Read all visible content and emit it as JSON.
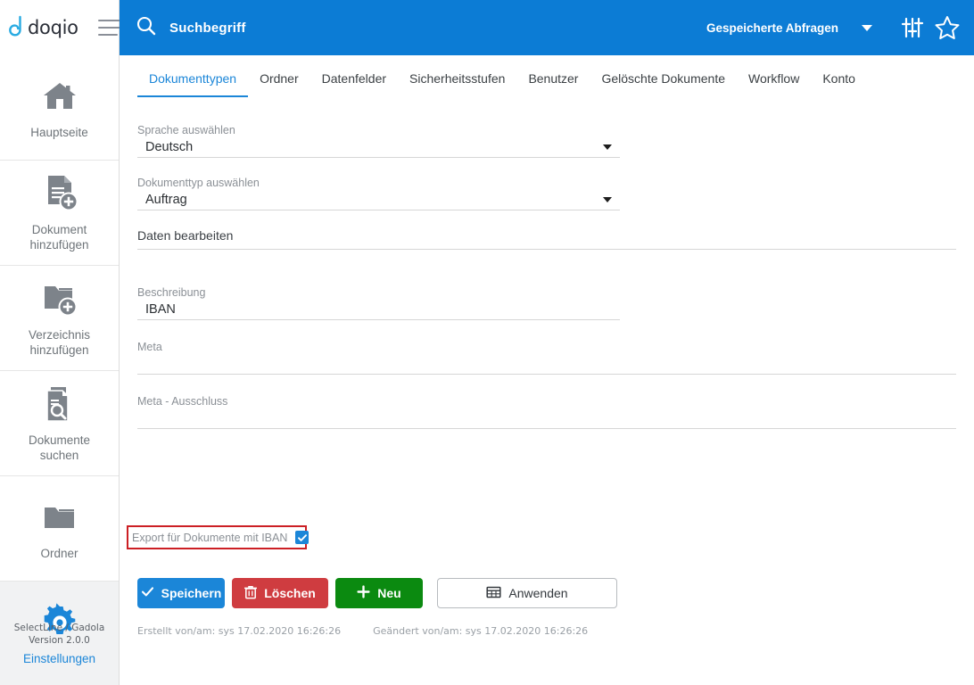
{
  "brand": {
    "name": "doqio",
    "logo_icon": "doqio-paperclip-logo",
    "menu_icon": "hamburger-menu-icon"
  },
  "topbar": {
    "search_placeholder": "Suchbegriff",
    "search_icon": "search-icon",
    "saved_queries_label": "Gespeicherte Abfragen",
    "caret_icon": "chevron-down-icon",
    "filters_icon": "sliders-filter-icon",
    "favorites_icon": "star-icon",
    "background_color": "#0c7cd5"
  },
  "sidebar": {
    "items": [
      {
        "label": "Hauptseite",
        "icon": "home-icon",
        "active": false
      },
      {
        "label": "Dokument\nhinzufügen",
        "icon": "document-add-icon",
        "active": false
      },
      {
        "label": "Verzeichnis\nhinzufügen",
        "icon": "folder-add-icon",
        "active": false
      },
      {
        "label": "Dokumente\nsuchen",
        "icon": "document-search-icon",
        "active": false
      },
      {
        "label": "Ordner",
        "icon": "folder-icon",
        "active": false
      },
      {
        "label": "Einstellungen",
        "icon": "gear-icon",
        "active": true
      }
    ],
    "footer_line1": "SelectLine / Gadola",
    "footer_line2": "Version 2.0.0"
  },
  "tabs": [
    {
      "label": "Dokumenttypen",
      "active": true
    },
    {
      "label": "Ordner",
      "active": false
    },
    {
      "label": "Datenfelder",
      "active": false
    },
    {
      "label": "Sicherheitsstufen",
      "active": false
    },
    {
      "label": "Benutzer",
      "active": false
    },
    {
      "label": "Gelöschte Dokumente",
      "active": false
    },
    {
      "label": "Workflow",
      "active": false
    },
    {
      "label": "Konto",
      "active": false
    }
  ],
  "form": {
    "language_select": {
      "label": "Sprache auswählen",
      "value": "Deutsch",
      "caret_icon": "chevron-down-icon"
    },
    "doctype_select": {
      "label": "Dokumenttyp auswählen",
      "value": "Auftrag",
      "caret_icon": "chevron-down-icon"
    },
    "section_title": "Daten bearbeiten",
    "description_field": {
      "label": "Beschreibung",
      "value": "IBAN"
    },
    "meta_field": {
      "label": "Meta",
      "value": ""
    },
    "meta_exclusion_field": {
      "label": "Meta - Ausschluss",
      "value": ""
    },
    "export_checkbox": {
      "label": "Export für Dokumente mit IBAN",
      "checked": true,
      "check_icon": "checkmark-icon",
      "highlight_color": "#cc1f24"
    }
  },
  "buttons": {
    "save": {
      "label": "Speichern",
      "icon": "check-icon",
      "color": "#1b86d8"
    },
    "delete": {
      "label": "Löschen",
      "icon": "trash-icon",
      "color": "#cf3c40"
    },
    "new": {
      "label": "Neu",
      "icon": "plus-icon",
      "color": "#0b8a10"
    },
    "apply": {
      "label": "Anwenden",
      "icon": "table-icon",
      "color": "#ffffff"
    }
  },
  "record_info": {
    "created": "Erstellt von/am: sys 17.02.2020 16:26:26",
    "modified": "Geändert von/am: sys 17.02.2020 16:26:26"
  }
}
